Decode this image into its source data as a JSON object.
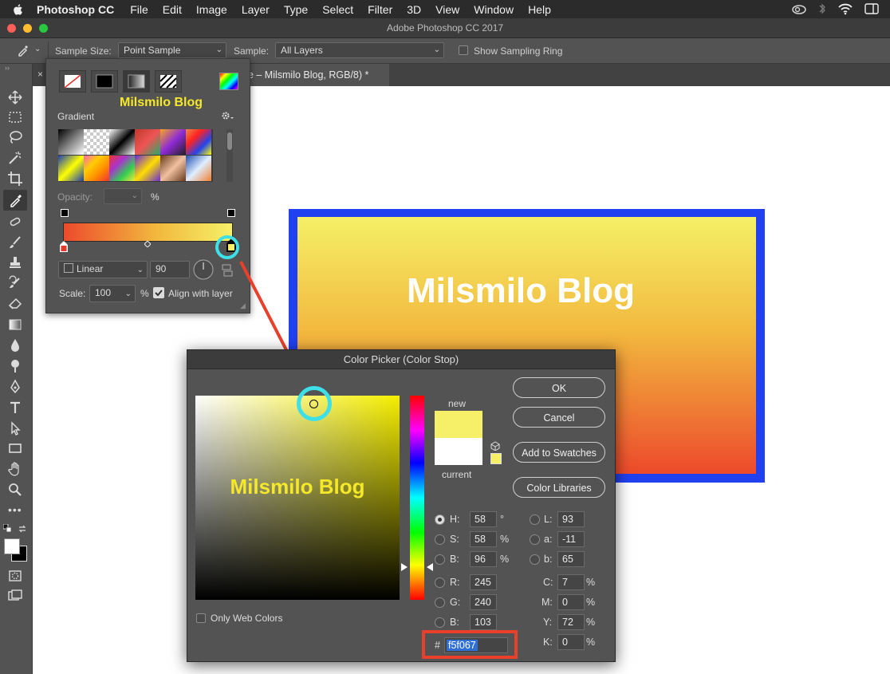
{
  "menubar": {
    "app_name": "Photoshop CC",
    "items": [
      "File",
      "Edit",
      "Image",
      "Layer",
      "Type",
      "Select",
      "Filter",
      "3D",
      "View",
      "Window",
      "Help"
    ]
  },
  "window": {
    "title": "Adobe Photoshop CC 2017"
  },
  "options_bar": {
    "sample_size_label": "Sample Size:",
    "sample_size_value": "Point Sample",
    "sample_label": "Sample:",
    "sample_value": "All Layers",
    "show_ring_label": "Show Sampling Ring"
  },
  "document": {
    "tab_label": "pe – Milsmilo Blog, RGB/8) *",
    "canvas_text": "Milsmilo Blog"
  },
  "gradient_panel": {
    "watermark": "Milsmilo Blog",
    "gradient_label": "Gradient",
    "opacity_label": "Opacity:",
    "opacity_unit": "%",
    "style_value": "Linear",
    "angle_value": "90",
    "scale_label": "Scale:",
    "scale_value": "100",
    "scale_unit": "%",
    "align_label": "Align with layer",
    "align_checked": true
  },
  "color_picker": {
    "title": "Color Picker (Color Stop)",
    "watermark": "Milsmilo Blog",
    "new_label": "new",
    "current_label": "current",
    "only_web_label": "Only Web Colors",
    "buttons": {
      "ok": "OK",
      "cancel": "Cancel",
      "add_swatches": "Add to Swatches",
      "libraries": "Color Libraries"
    },
    "hsb": {
      "h_label": "H:",
      "h": "58",
      "h_unit": "°",
      "s_label": "S:",
      "s": "58",
      "s_unit": "%",
      "b_label": "B:",
      "b": "96",
      "b_unit": "%"
    },
    "rgb": {
      "r_label": "R:",
      "r": "245",
      "g_label": "G:",
      "g": "240",
      "b_label": "B:",
      "b": "103"
    },
    "lab": {
      "l_label": "L:",
      "l": "93",
      "a_label": "a:",
      "a": "-11",
      "b_label": "b:",
      "b": "65"
    },
    "cmyk": {
      "c_label": "C:",
      "c": "7",
      "m_label": "M:",
      "m": "0",
      "y_label": "Y:",
      "y": "72",
      "k_label": "K:",
      "k": "0",
      "unit": "%"
    },
    "hex_label": "#",
    "hex": "f5f067",
    "new_color": "#f5f067",
    "current_color": "#ffffff"
  },
  "colors": {
    "accent_highlight": "#3ee0e8",
    "annotation_red": "#e8402a",
    "canvas_frame": "#2140f0"
  }
}
